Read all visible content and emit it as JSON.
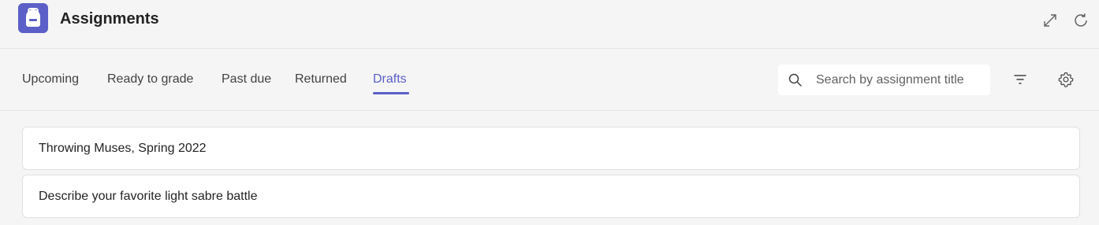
{
  "app": {
    "title": "Assignments",
    "icon": "backpack-icon",
    "accent_color": "#5b5fc7"
  },
  "header_actions": {
    "expand_icon": "expand-icon",
    "refresh_icon": "refresh-icon"
  },
  "tabs": [
    {
      "label": "Upcoming",
      "active": false
    },
    {
      "label": "Ready to grade",
      "active": false
    },
    {
      "label": "Past due",
      "active": false
    },
    {
      "label": "Returned",
      "active": false
    },
    {
      "label": "Drafts",
      "active": true
    }
  ],
  "search": {
    "placeholder": "Search by assignment title",
    "value": ""
  },
  "toolbar_actions": {
    "filter_icon": "filter-icon",
    "settings_icon": "gear-icon"
  },
  "assignments": [
    {
      "title": "Throwing Muses, Spring 2022"
    },
    {
      "title": "Describe your favorite light sabre battle"
    }
  ]
}
